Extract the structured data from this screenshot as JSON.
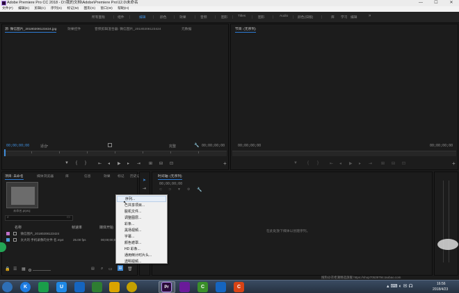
{
  "window": {
    "title": "Adobe Premiere Pro CC 2018 - D:\\我的文档\\Adobe\\Premiere Pro\\12.0\\未命名",
    "controls": [
      "—",
      "☐",
      "✕"
    ]
  },
  "menubar": [
    "文件(F)",
    "编辑(E)",
    "剪辑(C)",
    "序列(S)",
    "标记(M)",
    "图形(G)",
    "窗口(W)",
    "帮助(H)"
  ],
  "workspaces": {
    "items": [
      "所有面板",
      "组件",
      "编辑",
      "颜色",
      "效果",
      "音频",
      "图形",
      "Titles",
      "图形",
      "Audio",
      "颜色(旧版)",
      "库",
      "学习",
      "编辑"
    ],
    "active": "编辑",
    "more": "»"
  },
  "source_monitor": {
    "tabs": [
      "源: 微信图片_20180208123424.jpg",
      "效果控件",
      "音频剪辑混合器: 微信图片_20180208123424",
      "元数据"
    ],
    "timecode_left": "00;00;00;00",
    "fit_label": "适合",
    "quality_label": "完整",
    "timecode_right": "00;00;00;00"
  },
  "program_monitor": {
    "tab": "节目: (无序列)",
    "timecode_left": "00;00;00;00",
    "timecode_right": "00;00;00;00"
  },
  "project_panel": {
    "tabs": [
      "项目: 未命名",
      "媒体浏览器",
      "库",
      "信息",
      "效果",
      "标记",
      "历史记录"
    ],
    "thumb_caption": "未命名.prproj",
    "headers": [
      "名称",
      "帧速率",
      "媒体开始"
    ],
    "items": [
      {
        "color": "#c070c8",
        "icon": "image-icon",
        "name": "微信图片_20180208123424",
        "fps": "",
        "start": ""
      },
      {
        "color": "#4a9bd8",
        "icon": "video-icon",
        "name": "太大的 手机录像的文件 名.mp4",
        "fps": "25.00 fps",
        "start": "00;00;00;00"
      }
    ]
  },
  "timeline_panel": {
    "tab": "时间轴: (无序列)",
    "timecode": "00;00;00;00",
    "empty_hint": "在此处放下媒体以创建序列。"
  },
  "context_menu": {
    "items": [
      "序列...",
      "已共享项目...",
      "脱机文件...",
      "调整图层...",
      "彩条...",
      "黑场视频...",
      "字幕...",
      "颜色遮罩...",
      "HD 彩条...",
      "通用倒计时片头...",
      "透明视频..."
    ],
    "highlighted": 0
  },
  "taskbar": {
    "apps": [
      {
        "label": "",
        "color": "#2e6fb6",
        "icon": "windows-start-icon"
      },
      {
        "label": "K",
        "color": "#1d7be0",
        "icon": "kugou-icon"
      },
      {
        "label": "",
        "color": "#1a9e4a",
        "icon": "wechat-icon"
      },
      {
        "label": "U",
        "color": "#1e88e5",
        "icon": "upan-icon"
      },
      {
        "label": "",
        "color": "#1565c0",
        "icon": "screen-icon"
      },
      {
        "label": "",
        "color": "#2e7d32",
        "icon": "browser-icon"
      },
      {
        "label": "",
        "color": "#d9a400",
        "icon": "folder-icon"
      },
      {
        "label": "",
        "color": "#c4a000",
        "icon": "360-icon"
      },
      {
        "label": "Pr",
        "color": "#2a0b3a",
        "icon": "premiere-icon"
      },
      {
        "label": "",
        "color": "#6a1b9a",
        "icon": "media-encoder-icon"
      },
      {
        "label": "C",
        "color": "#3a8f2a",
        "icon": "camtasia-icon"
      },
      {
        "label": "",
        "color": "#1565c0",
        "icon": "word-icon"
      },
      {
        "label": "C",
        "color": "#d84315",
        "icon": "capture-icon"
      }
    ],
    "watermark": "搜狗@衣柜潮精选旗舰 https://shop70539794.taobao.com",
    "time": "16:56",
    "date": "2018/4/23"
  }
}
